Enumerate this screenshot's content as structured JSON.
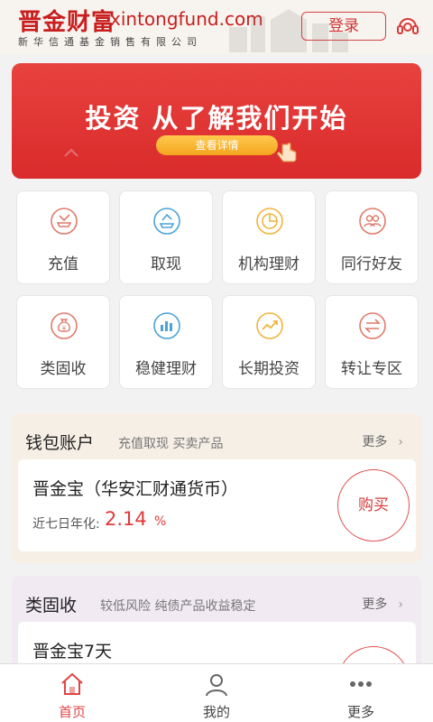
{
  "header": {
    "brand_cn": "晋金财富",
    "brand_url": "xintongfund.com",
    "brand_sub": "新华信通基金销售有限公司",
    "login_label": "登录",
    "accent": "#c81e1e",
    "support_icon": "headset-icon"
  },
  "banner": {
    "title": "投资 从了解我们开始",
    "button_label": "查看详情",
    "bg_color": "#e23a37",
    "button_color": "#f5ab25"
  },
  "grid": {
    "items": [
      {
        "label": "充值",
        "icon": "deposit-icon"
      },
      {
        "label": "取现",
        "icon": "withdraw-icon"
      },
      {
        "label": "机构理财",
        "icon": "pie-chart-icon"
      },
      {
        "label": "同行好友",
        "icon": "friends-icon"
      },
      {
        "label": "类固收",
        "icon": "money-bag-icon"
      },
      {
        "label": "稳健理财",
        "icon": "bar-chart-icon"
      },
      {
        "label": "长期投资",
        "icon": "trend-icon"
      },
      {
        "label": "转让专区",
        "icon": "transfer-icon"
      }
    ]
  },
  "wallet": {
    "title": "钱包账户",
    "subtitle": "充值取现 买卖产品",
    "more_label": "更多",
    "product": {
      "name": "晋金宝（华安汇财通货币）",
      "yield_label": "近七日年化:",
      "yield_value": "2.14",
      "yield_unit": "%",
      "buy_label": "购买"
    }
  },
  "fixed_income": {
    "title": "类固收",
    "subtitle": "较低风险 纯债产品收益稳定",
    "more_label": "更多",
    "product": {
      "name": "晋金宝7天"
    }
  },
  "bottom_nav": {
    "items": [
      {
        "label": "首页",
        "icon": "home-icon",
        "active": true
      },
      {
        "label": "我的",
        "icon": "user-icon",
        "active": false
      },
      {
        "label": "更多",
        "icon": "more-dots-icon",
        "active": false
      }
    ],
    "active_color": "#e04646"
  }
}
